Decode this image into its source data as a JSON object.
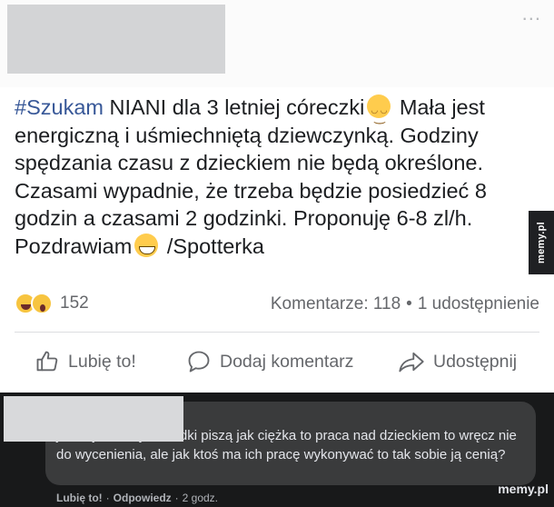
{
  "post": {
    "hashtag": "#Szukam",
    "text_line1": " NIANI dla  3 letniej córeczki",
    "text_line1_end": " Mała",
    "text_rest": "jest energiczną i uśmiechniętą dziewczynką. Godziny spędzania czasu z dzieckiem nie będą określone.  Czasami wypadnie, że trzeba będzie posiedzieć 8 godzin a czasami 2 godzinki. Proponuję 6-8 zl/h. Pozdrawiam",
    "text_end": " /Spotterka",
    "emoji_1": "smiling-face-emoji",
    "emoji_2": "grinning-face-emoji"
  },
  "menu": {
    "dots": "..."
  },
  "stats": {
    "reaction_count": "152",
    "comments_label": "Komentarze: 118",
    "separator": "•",
    "shares_label": "1 udostępnienie"
  },
  "actions": {
    "like": "Lubię to!",
    "comment": "Dodaj komentarz",
    "share": "Udostępnij"
  },
  "comment": {
    "text": "jak to jest, że jak Madki piszą jak ciężka to praca nad dzieckiem to wręcz nie do wycenienia, ale jak ktoś ma ich pracę wykonywać to tak sobie ją cenią?",
    "like": "Lubię to!",
    "dot": "·",
    "reply": "Odpowiedz",
    "dot2": "·",
    "time": "2 godz."
  },
  "watermark": {
    "side": "memy.pl",
    "bottom": "memy.pl"
  },
  "colors": {
    "hashtag": "#385898",
    "dark_bg": "#18191a",
    "bubble": "#3a3b3c"
  }
}
